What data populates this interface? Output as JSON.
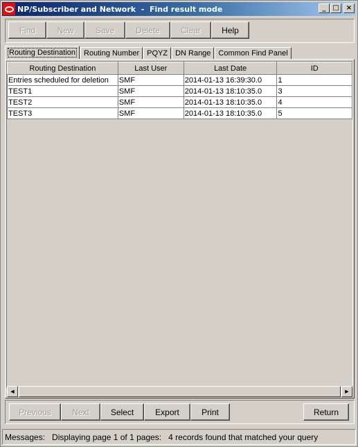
{
  "window": {
    "title": "NP/Subscriber and Network  -  Find result mode",
    "controls": {
      "minimize": "_",
      "maximize": "□",
      "close": "×"
    }
  },
  "toolbar": {
    "buttons": [
      {
        "label": "Find",
        "enabled": false
      },
      {
        "label": "New",
        "enabled": false
      },
      {
        "label": "Save",
        "enabled": false
      },
      {
        "label": "Delete",
        "enabled": false
      },
      {
        "label": "Clear",
        "enabled": false
      },
      {
        "label": "Help",
        "enabled": true
      }
    ]
  },
  "tabs": [
    {
      "label": "Routing Destination",
      "active": true
    },
    {
      "label": "Routing Number",
      "active": false
    },
    {
      "label": "PQYZ",
      "active": false
    },
    {
      "label": "DN Range",
      "active": false
    },
    {
      "label": "Common Find Panel",
      "active": false
    }
  ],
  "table": {
    "columns": [
      "Routing Destination",
      "Last User",
      "Last Date",
      "ID"
    ],
    "rows": [
      [
        "Entries scheduled for deletion",
        "SMF",
        "2014-01-13 16:39:30.0",
        "1"
      ],
      [
        "TEST1",
        "SMF",
        "2014-01-13 18:10:35.0",
        "3"
      ],
      [
        "TEST2",
        "SMF",
        "2014-01-13 18:10:35.0",
        "4"
      ],
      [
        "TEST3",
        "SMF",
        "2014-01-13 18:10:35.0",
        "5"
      ]
    ]
  },
  "scrollbar": {
    "left_arrow": "◀",
    "right_arrow": "▶"
  },
  "bottom_buttons": [
    {
      "label": "Previous",
      "enabled": false
    },
    {
      "label": "Next",
      "enabled": false
    },
    {
      "label": "Select",
      "enabled": true
    },
    {
      "label": "Export",
      "enabled": true
    },
    {
      "label": "Print",
      "enabled": true
    }
  ],
  "return_button": {
    "label": "Return",
    "enabled": true
  },
  "status": {
    "text": "Messages:   Displaying page 1 of 1 pages:   4 records found that matched your query"
  }
}
